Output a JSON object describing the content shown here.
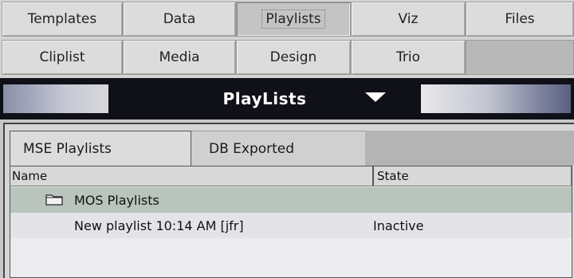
{
  "tabs": {
    "row1": [
      "Templates",
      "Data",
      "Playlists",
      "Viz",
      "Files"
    ],
    "row2": [
      "Cliplist",
      "Media",
      "Design",
      "Trio"
    ],
    "active": "Playlists"
  },
  "title": "PlayLists",
  "subtabs": [
    "MSE Playlists",
    "DB Exported"
  ],
  "columns": {
    "name": "Name",
    "state": "State"
  },
  "rows": [
    {
      "type": "folder",
      "name": "MOS Playlists",
      "state": "",
      "icon": "folder-icon"
    },
    {
      "type": "playlist",
      "name": "New playlist 10:14 AM [jfr]",
      "state": "Inactive"
    }
  ]
}
